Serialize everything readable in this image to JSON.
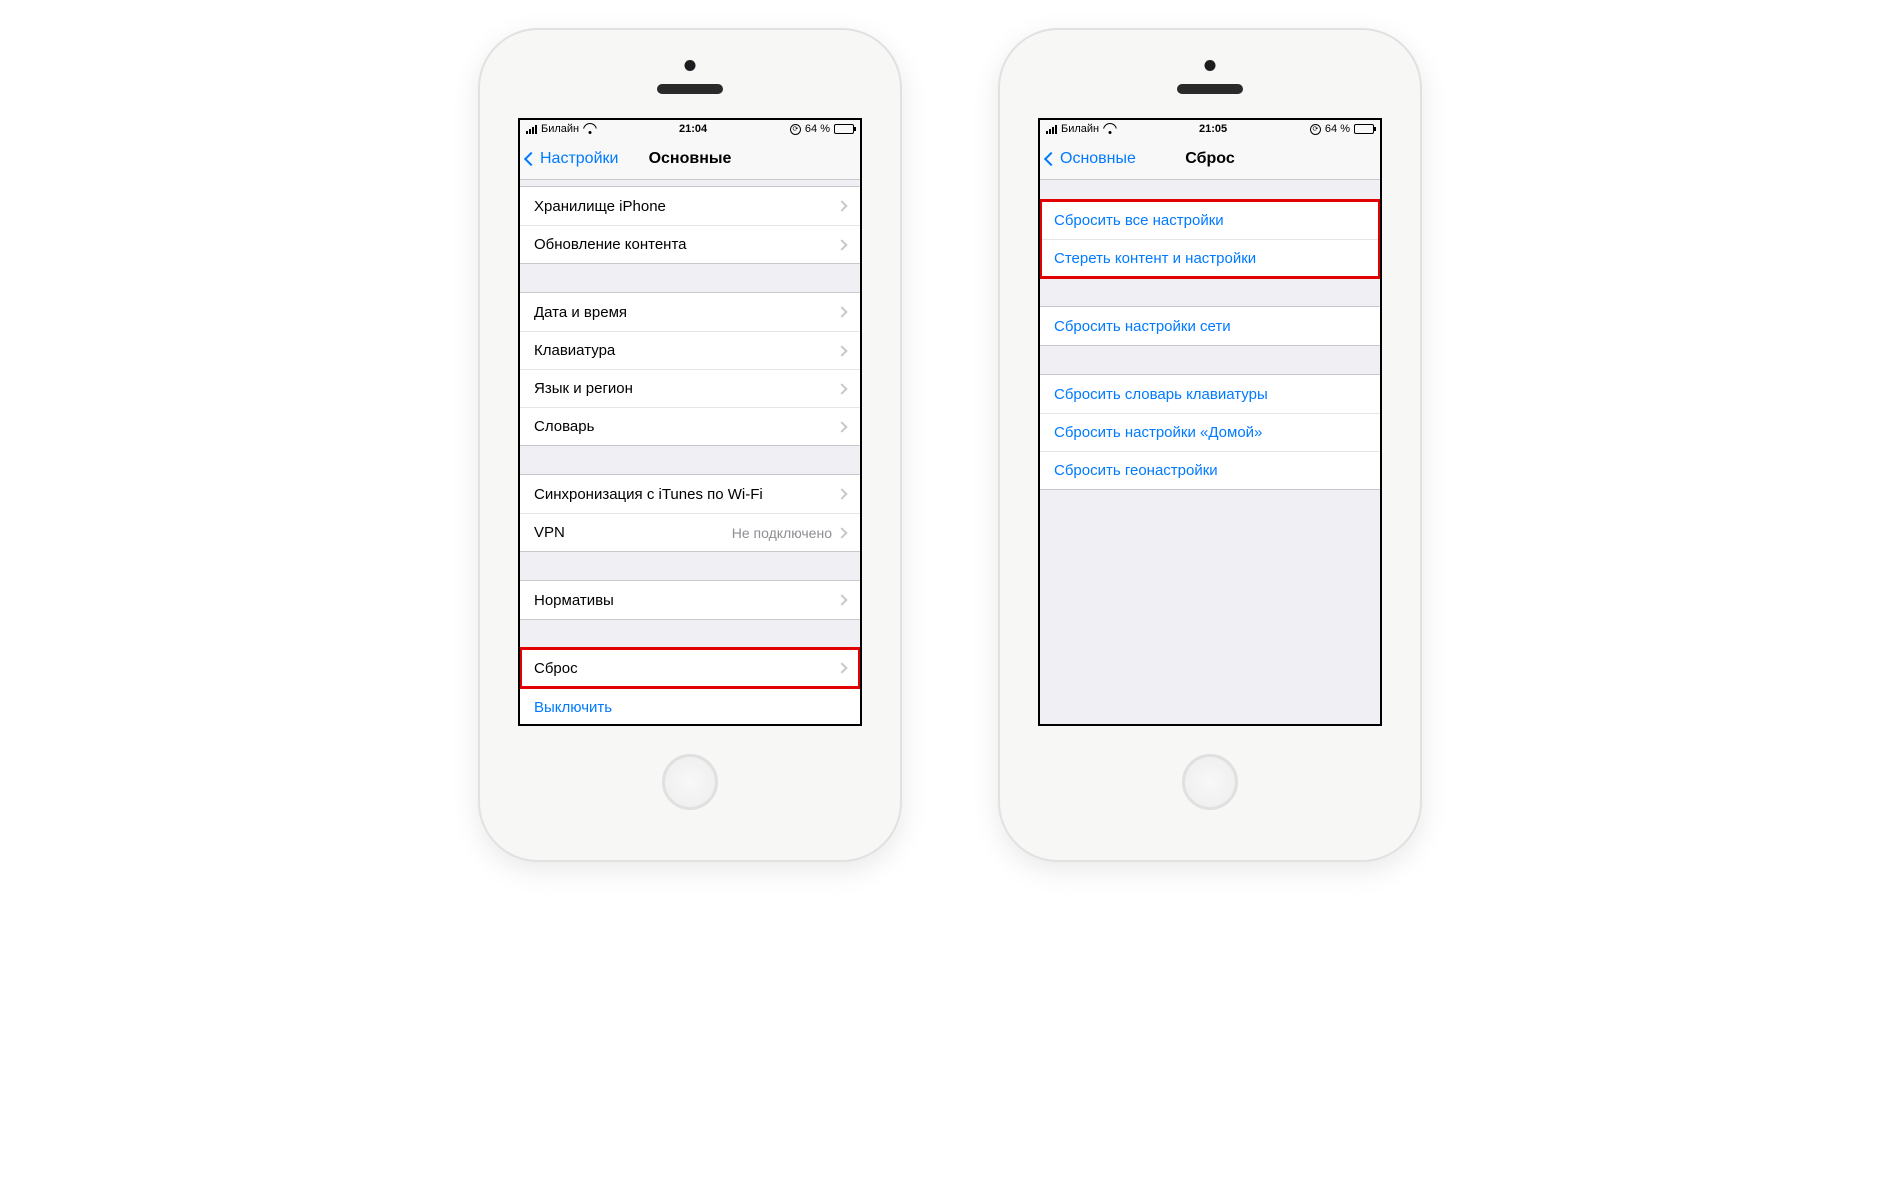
{
  "left": {
    "status": {
      "carrier": "Билайн",
      "time": "21:04",
      "battery": "64 %"
    },
    "nav": {
      "back": "Настройки",
      "title": "Основные"
    },
    "g1": [
      {
        "label": "Хранилище iPhone"
      },
      {
        "label": "Обновление контента"
      }
    ],
    "g2": [
      {
        "label": "Дата и время"
      },
      {
        "label": "Клавиатура"
      },
      {
        "label": "Язык и регион"
      },
      {
        "label": "Словарь"
      }
    ],
    "g3": [
      {
        "label": "Синхронизация с iTunes по Wi-Fi"
      },
      {
        "label": "VPN",
        "detail": "Не подключено"
      }
    ],
    "g4": [
      {
        "label": "Нормативы"
      }
    ],
    "g5": [
      {
        "label": "Сброс"
      }
    ],
    "shutdown": "Выключить"
  },
  "right": {
    "status": {
      "carrier": "Билайн",
      "time": "21:05",
      "battery": "64 %"
    },
    "nav": {
      "back": "Основные",
      "title": "Сброс"
    },
    "g1": [
      "Сбросить все настройки",
      "Стереть контент и настройки"
    ],
    "g2": [
      "Сбросить настройки сети"
    ],
    "g3": [
      "Сбросить словарь клавиатуры",
      "Сбросить настройки «Домой»",
      "Сбросить геонастройки"
    ]
  }
}
